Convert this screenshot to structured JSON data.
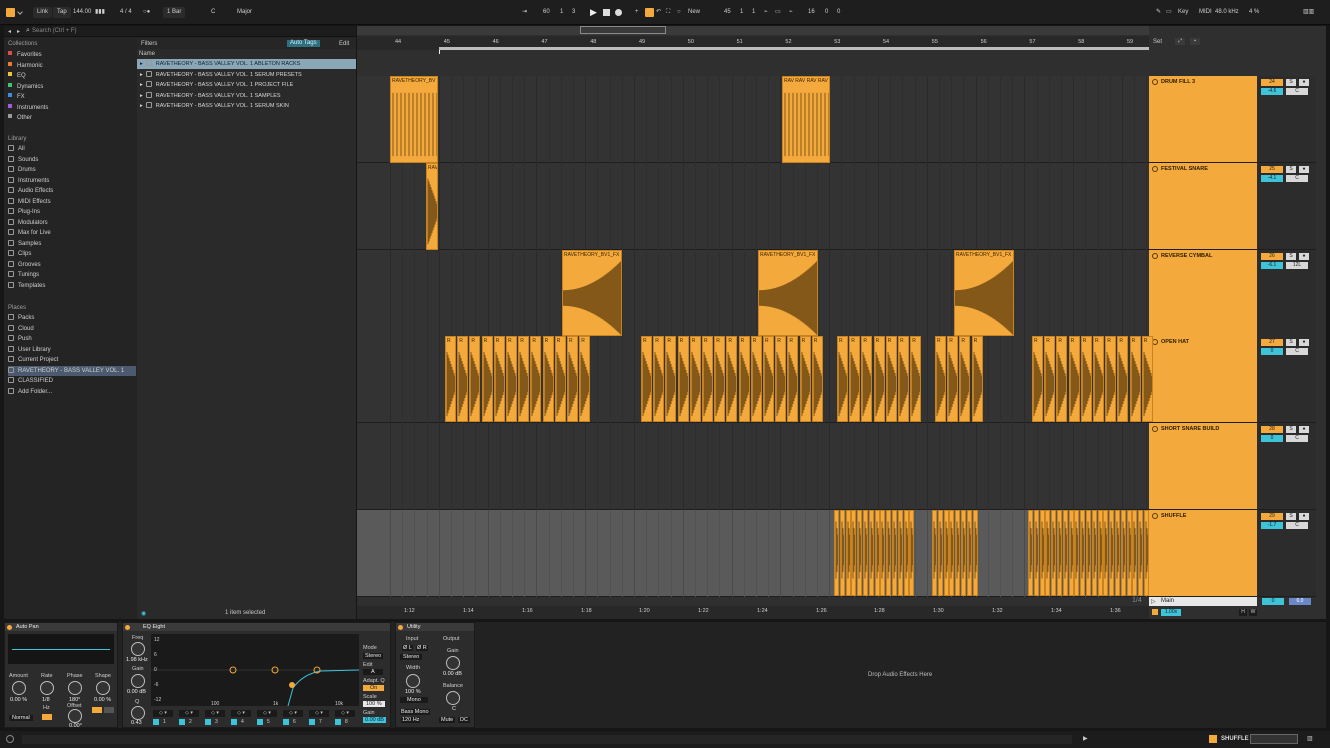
{
  "transport": {
    "link": "Link",
    "tap": "Tap",
    "bpm": "144.00",
    "signature": "4 / 4",
    "quantize": "1 Bar",
    "key": "C",
    "scale": "Major",
    "pos1": "60",
    "pos2": "1",
    "pos3": "3",
    "new": "New",
    "arr_pos1": "45",
    "arr_pos2": "1",
    "arr_pos3": "1",
    "loop1": "16",
    "loop2": "0",
    "loop3": "0",
    "key_btn": "Key",
    "midi_btn": "MIDI",
    "sample_rate": "48.0 kHz",
    "cpu": "4 %"
  },
  "browser": {
    "search_placeholder": "Search (Ctrl + F)",
    "filters": "Filters",
    "auto_tags": "Auto Tags",
    "edit": "Edit",
    "name_col": "Name",
    "status": "1 item selected",
    "collections_title": "Collections",
    "collections": [
      {
        "label": "Favorites",
        "color": "#e04a4a"
      },
      {
        "label": "Harmonic",
        "color": "#ee7a2f"
      },
      {
        "label": "EQ",
        "color": "#e8c53a"
      },
      {
        "label": "Dynamics",
        "color": "#42c46a"
      },
      {
        "label": "FX",
        "color": "#3f8be0"
      },
      {
        "label": "Instruments",
        "color": "#a25ad6"
      },
      {
        "label": "Other",
        "color": "#9a9a9a"
      }
    ],
    "library_title": "Library",
    "library": [
      "All",
      "Sounds",
      "Drums",
      "Instruments",
      "Audio Effects",
      "MIDI Effects",
      "Plug-Ins",
      "Modulators",
      "Max for Live",
      "Samples",
      "Clips",
      "Grooves",
      "Tunings",
      "Templates"
    ],
    "places_title": "Places",
    "places": [
      "Packs",
      "Cloud",
      "Push",
      "User Library",
      "Current Project",
      "RAVETHEORY - BASS VALLEY VOL. 1",
      "CLASSIFIED",
      "Add Folder..."
    ],
    "items": [
      "RAVETHEORY - BASS VALLEY VOL. 1 ABLETON RACKS",
      "RAVETHEORY - BASS VALLEY VOL. 1 SERUM PRESETS",
      "RAVETHEORY - BASS VALLEY VOL. 1 PROJECT FILE",
      "RAVETHEORY - BASS VALLEY VOL. 1 SAMPLES",
      "RAVETHEORY - BASS VALLEY VOL. 1 SERUM SKIN"
    ]
  },
  "arrangement": {
    "set_label": "Set",
    "bars": [
      "44",
      "45",
      "46",
      "47",
      "48",
      "49",
      "50",
      "51",
      "52",
      "53",
      "54",
      "55",
      "56",
      "57",
      "58",
      "59"
    ],
    "times": [
      "1:12",
      "1:14",
      "1:16",
      "1:18",
      "1:20",
      "1:22",
      "1:24",
      "1:26",
      "1:28",
      "1:30",
      "1:32",
      "1:34",
      "1:36"
    ],
    "zoom_label": "1/4",
    "tracks": [
      {
        "name": "DRUM FILL 3",
        "num": "24",
        "vol": "-4.6",
        "pan": "C"
      },
      {
        "name": "FESTIVAL SNARE",
        "num": "25",
        "vol": "-4.1",
        "pan": "C"
      },
      {
        "name": "REVERSE CYMBAL",
        "num": "26",
        "vol": "-6.1",
        "pan": "12L"
      },
      {
        "name": "OPEN HAT",
        "num": "27",
        "vol": "0",
        "pan": "C"
      },
      {
        "name": "SHORT SNARE BUILD",
        "num": "28",
        "vol": "0",
        "pan": "C"
      },
      {
        "name": "SHUFFLE",
        "num": "29",
        "vol": "-1.7",
        "pan": "C"
      }
    ],
    "main_label": "Main",
    "main_vol": "0",
    "main_db": "6.0",
    "zoom_val": "1.00x",
    "h_btn": "H",
    "w_btn": "W",
    "clip_fill": "RAVETHEORY_BV",
    "clip_fill2": "RAV RAV RAV RAV",
    "clip_snare": "RAV",
    "clip_fx": "RAVETHEORY_BV1_FX",
    "clip_hat": "R"
  },
  "devices": {
    "autopan": {
      "title": "Auto Pan",
      "amount_l": "Amount",
      "amount": "0.00 %",
      "rate_l": "Rate",
      "rate": "1/8",
      "phase_l": "Phase",
      "phase": "180°",
      "shape_l": "Shape",
      "shape": "0.00 %",
      "offset_l": "Offset",
      "offset": "0.00°",
      "normal": "Normal",
      "hz": "Hz"
    },
    "eq": {
      "title": "EQ Eight",
      "freq_l": "Freq",
      "freq": "1.98 kHz",
      "gain_l": "Gain",
      "gain": "0.00 dB",
      "q_l": "Q",
      "q": "0.43",
      "mode_l": "Mode",
      "mode": "Stereo",
      "edit_l": "Edit",
      "edit": "A",
      "adapt_l": "Adapt. Q",
      "adapt": "On",
      "scale_l": "Scale",
      "scale": "100 %",
      "gain2_l": "Gain",
      "gain2": "0.00 dB",
      "ylab": [
        "12",
        "6",
        "0",
        "-6",
        "-12"
      ],
      "xlab": [
        "100",
        "1k",
        "10k"
      ],
      "bands": [
        "1",
        "2",
        "3",
        "4",
        "5",
        "6",
        "7",
        "8"
      ]
    },
    "utility": {
      "title": "Utility",
      "input_l": "Input",
      "output_l": "Output",
      "phl": "Ø L",
      "phr": "Ø R",
      "stereo": "Stereo",
      "gain_l": "Gain",
      "gain": "0.00 dB",
      "width_l": "Width",
      "width": "100 %",
      "mono": "Mono",
      "balance_l": "Balance",
      "balance": "C",
      "bassmono": "Bass Mono",
      "bassfreq": "120 Hz",
      "mute": "Mute",
      "dc": "DC"
    },
    "drop": "Drop Audio Effects Here"
  },
  "statusbar": {
    "track": "SHUFFLE"
  },
  "colors": {
    "clip": "#f4a93c",
    "accent": "#f4a93c",
    "vol": "#3ec3d8"
  }
}
